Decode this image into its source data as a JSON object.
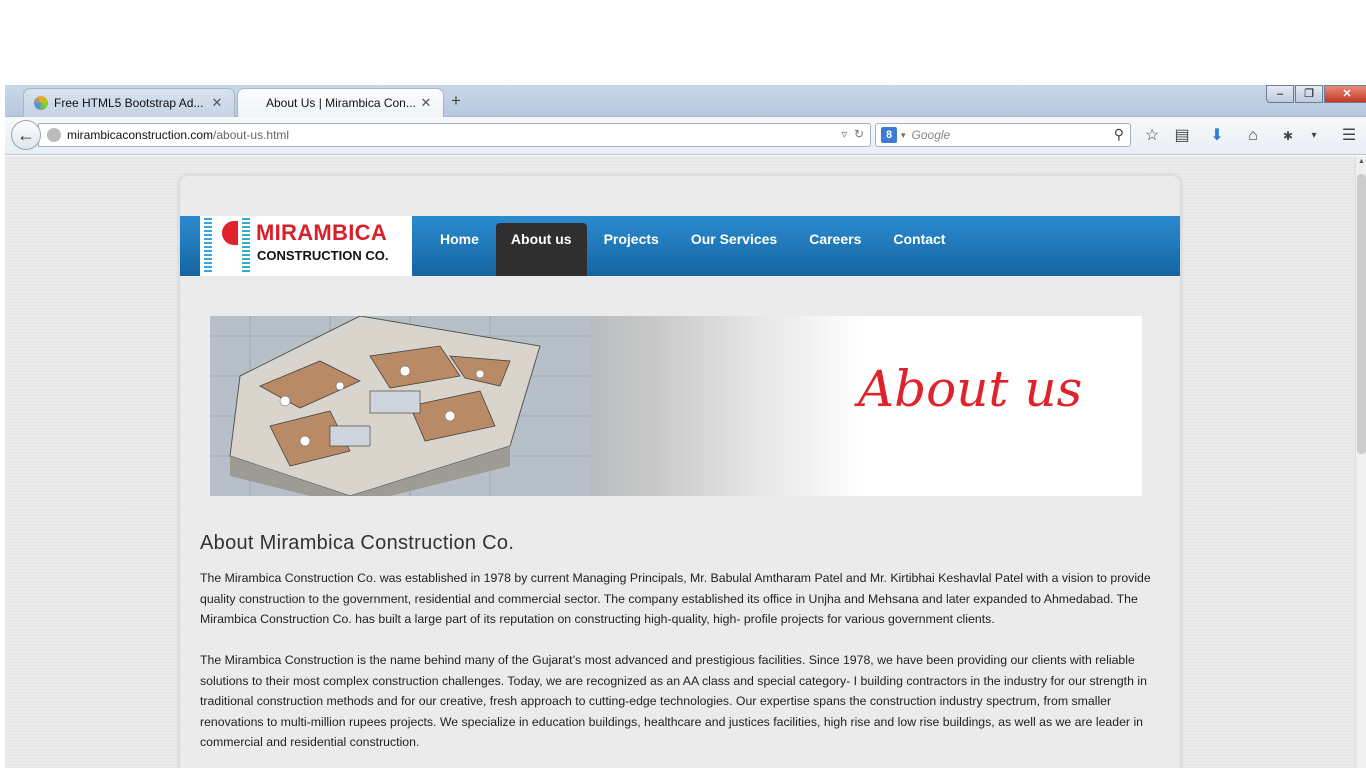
{
  "browser": {
    "tabs": [
      {
        "title": "Free HTML5 Bootstrap Ad...",
        "active": false,
        "icon": "spinner-icon"
      },
      {
        "title": "About Us | Mirambica Con...",
        "active": true
      }
    ],
    "url_host": "mirambicaconstruction.com",
    "url_path": "/about-us.html",
    "search_placeholder": "Google",
    "search_engine_badge": "8",
    "toolbar_icons": [
      "bookmark-star-icon",
      "reading-list-icon",
      "download-icon",
      "home-icon",
      "addon-icon",
      "menu-icon"
    ]
  },
  "site": {
    "logo_name": "MIRAMBICA",
    "logo_sub": "CONSTRUCTION CO.",
    "nav": [
      "Home",
      "About us",
      "Projects",
      "Our Services",
      "Careers",
      "Contact"
    ],
    "active_nav": "About us",
    "banner_text": "About us",
    "heading": "About Mirambica Construction Co.",
    "paragraph1": "The Mirambica Construction Co. was established in 1978 by current Managing Principals, Mr. Babulal Amtharam Patel and Mr. Kirtibhai Keshavlal Patel with a vision to provide quality construction to the government, residential and commercial sector. The company established its office in Unjha and Mehsana and later expanded to Ahmedabad. The Mirambica Construction Co. has built a large part of its reputation on constructing high-quality, high- profile projects for various government clients.",
    "paragraph2": "The Mirambica Construction is the name behind many of the Gujarat’s most advanced and prestigious facilities. Since 1978, we have been providing our clients with reliable solutions to their most complex construction challenges. Today, we are recognized as an AA class and special category- I building contractors in the industry for our strength in traditional construction methods and for our creative, fresh approach to cutting-edge technologies. Our expertise spans the construction industry spectrum, from smaller renovations to multi-million rupees projects. We specialize in education buildings, healthcare and justices facilities, high rise and low rise buildings, as well as we are leader in commercial and residential construction."
  },
  "colors": {
    "nav_blue": "#1f7bbf",
    "brand_red": "#e0232b",
    "active_nav": "#2f2f2f"
  }
}
